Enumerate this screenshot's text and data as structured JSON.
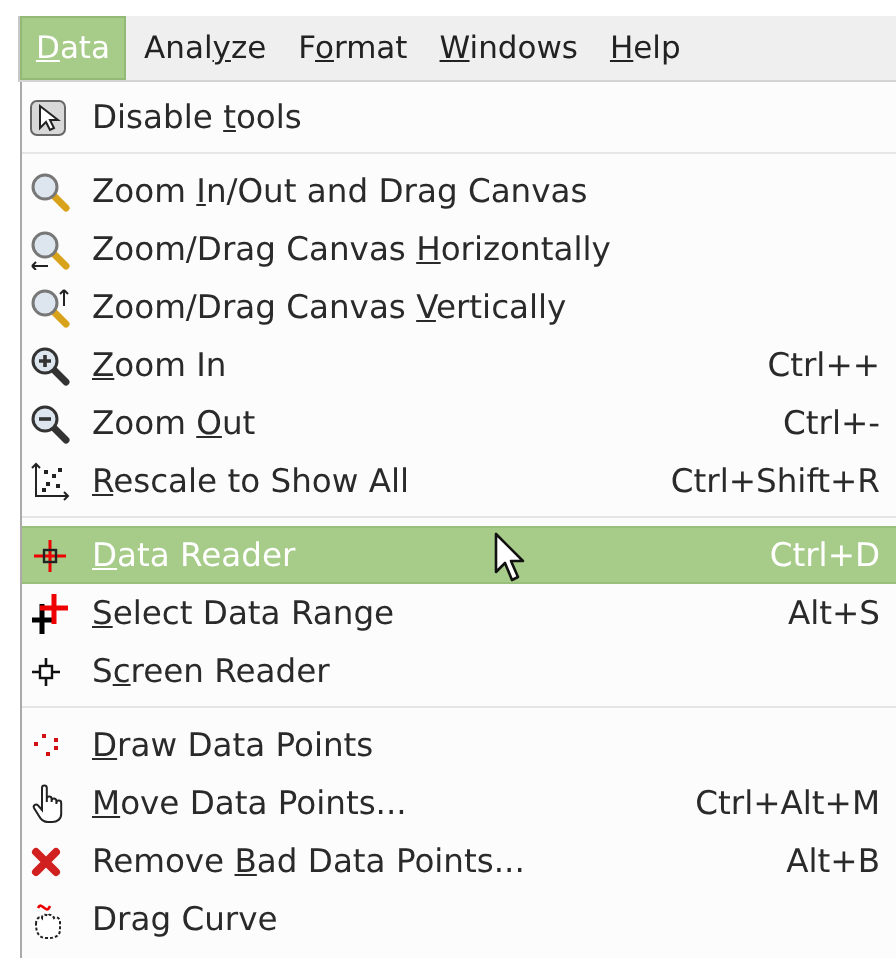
{
  "menubar": [
    {
      "key": "D",
      "post": "ata",
      "selected": true
    },
    {
      "pre": "Anal",
      "key": "y",
      "post": "ze",
      "selected": false
    },
    {
      "pre": "F",
      "key": "o",
      "post": "rmat",
      "selected": false
    },
    {
      "key": "W",
      "post": "indows",
      "selected": false
    },
    {
      "key": "H",
      "post": "elp",
      "selected": false
    }
  ],
  "menu": [
    {
      "kind": "item",
      "pre": "Disable ",
      "key": "t",
      "post": "ools",
      "selected": false
    },
    {
      "kind": "separator"
    },
    {
      "kind": "item",
      "pre": "Zoom ",
      "key": "I",
      "post": "n/Out and Drag Canvas",
      "selected": false
    },
    {
      "kind": "item",
      "pre": "Zoom/Drag Canvas ",
      "key": "H",
      "post": "orizontally",
      "selected": false
    },
    {
      "kind": "item",
      "pre": "Zoom/Drag Canvas ",
      "key": "V",
      "post": "ertically",
      "selected": false
    },
    {
      "kind": "item",
      "key": "Z",
      "post": "oom In",
      "shortcut": "Ctrl++",
      "selected": false
    },
    {
      "kind": "item",
      "pre": "Zoom ",
      "key": "O",
      "post": "ut",
      "shortcut": "Ctrl+-",
      "selected": false
    },
    {
      "kind": "item",
      "key": "R",
      "post": "escale to Show All",
      "shortcut": "Ctrl+Shift+R",
      "selected": false
    },
    {
      "kind": "separator"
    },
    {
      "kind": "item",
      "key": "D",
      "post": "ata Reader",
      "shortcut": "Ctrl+D",
      "selected": true
    },
    {
      "kind": "item",
      "key": "S",
      "post": "elect Data Range",
      "shortcut": "Alt+S",
      "selected": false
    },
    {
      "kind": "item",
      "pre": "S",
      "key": "c",
      "post": "reen Reader",
      "selected": false
    },
    {
      "kind": "separator"
    },
    {
      "kind": "item",
      "key": "D",
      "post": "raw Data Points",
      "selected": false
    },
    {
      "kind": "item",
      "key": "M",
      "post": "ove Data Points...",
      "shortcut": "Ctrl+Alt+M",
      "selected": false
    },
    {
      "kind": "item",
      "pre": "Remove ",
      "key": "B",
      "post": "ad Data Points...",
      "shortcut": "Alt+B",
      "selected": false
    },
    {
      "kind": "item",
      "pre": "Drag Curve",
      "selected": false
    }
  ]
}
